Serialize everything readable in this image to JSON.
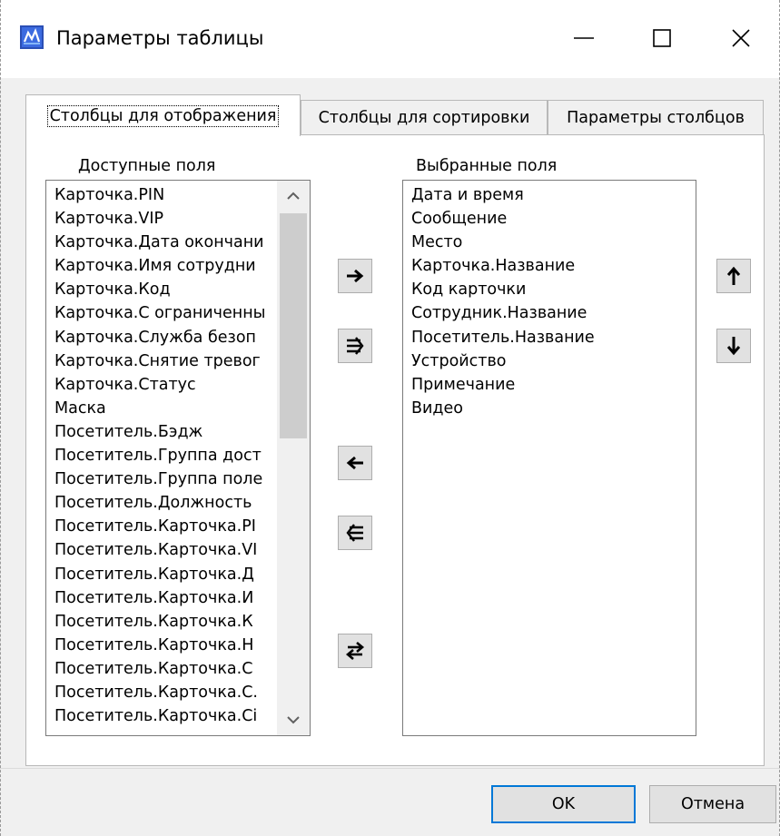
{
  "window": {
    "title": "Параметры таблицы"
  },
  "tabs": [
    {
      "label": "Столбцы для отображения",
      "active": true
    },
    {
      "label": "Столбцы для сортировки",
      "active": false
    },
    {
      "label": "Параметры столбцов",
      "active": false
    }
  ],
  "available": {
    "label": "Доступные поля",
    "items": [
      "Карточка.PIN",
      "Карточка.VIP",
      "Карточка.Дата окончани",
      "Карточка.Имя сотрудни",
      "Карточка.Код",
      "Карточка.С ограниченны",
      "Карточка.Служба безоп",
      "Карточка.Снятие тревог",
      "Карточка.Статус",
      "Маска",
      "Посетитель.Бэдж",
      "Посетитель.Группа дост",
      "Посетитель.Группа поле",
      "Посетитель.Должность",
      "Посетитель.Карточка.PI",
      "Посетитель.Карточка.VI",
      "Посетитель.Карточка.Д",
      "Посетитель.Карточка.И",
      "Посетитель.Карточка.К",
      "Посетитель.Карточка.Н",
      "Посетитель.Карточка.С",
      "Посетитель.Карточка.С.",
      "Посетитель.Карточка.Сі"
    ]
  },
  "selected": {
    "label": "Выбранные поля",
    "items": [
      "Дата и время",
      "Сообщение",
      "Место",
      "Карточка.Название",
      "Код карточки",
      "Сотрудник.Название",
      "Посетитель.Название",
      "Устройство",
      "Примечание",
      "Видео"
    ]
  },
  "transfer_buttons": {
    "add": "arrow-right-icon",
    "add_all": "double-arrow-right-icon",
    "remove": "arrow-left-icon",
    "remove_all": "double-arrow-left-icon",
    "swap": "swap-arrows-icon",
    "move_up": "arrow-up-icon",
    "move_down": "arrow-down-icon"
  },
  "footer": {
    "ok_label": "OK",
    "cancel_label": "Отмена"
  },
  "colors": {
    "dialog_background": "#f0f0f0",
    "focus_border": "#0078d7",
    "scroll_thumb": "#cdcdcd"
  }
}
